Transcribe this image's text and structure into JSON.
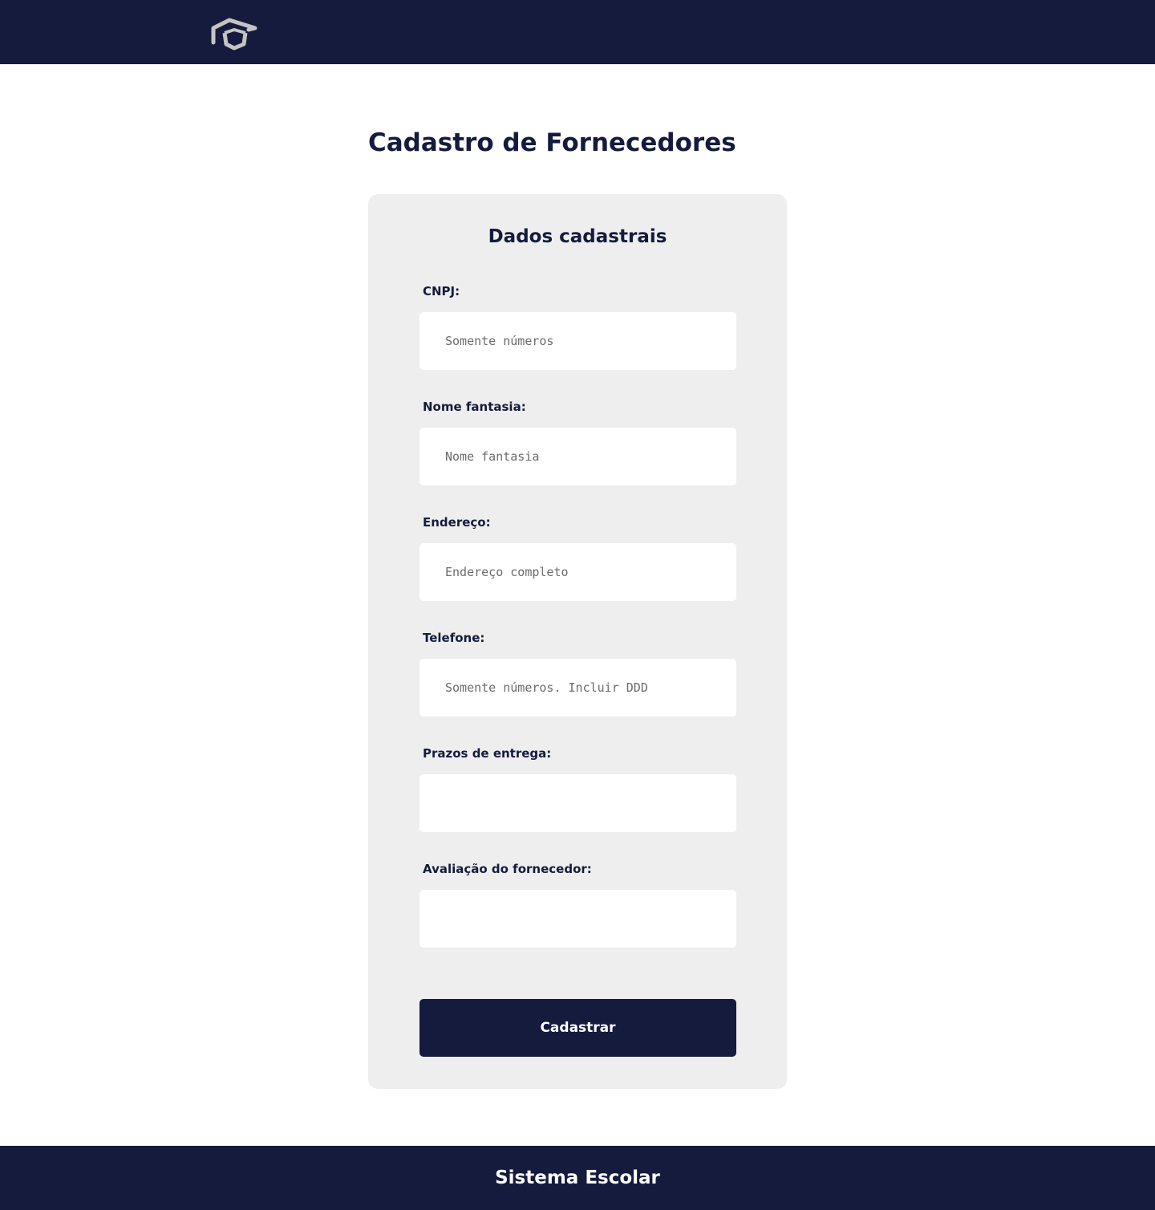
{
  "header": {
    "logo_icon": "graduation-cap-icon"
  },
  "main": {
    "title": "Cadastro de Fornecedores"
  },
  "form": {
    "title": "Dados cadastrais",
    "fields": [
      {
        "label": "CNPJ:",
        "placeholder": "Somente números",
        "value": ""
      },
      {
        "label": "Nome fantasia:",
        "placeholder": "Nome fantasia",
        "value": ""
      },
      {
        "label": "Endereço:",
        "placeholder": "Endereço completo",
        "value": ""
      },
      {
        "label": "Telefone:",
        "placeholder": "Somente números. Incluir DDD",
        "value": ""
      },
      {
        "label": "Prazos de entrega:",
        "placeholder": "",
        "value": ""
      },
      {
        "label": "Avaliação do fornecedor:",
        "placeholder": "",
        "value": ""
      }
    ],
    "submit_label": "Cadastrar"
  },
  "footer": {
    "text": "Sistema Escolar"
  },
  "colors": {
    "primary": "#141b3d",
    "card_background": "#eeeeee",
    "logo": "#c4c4c4"
  }
}
